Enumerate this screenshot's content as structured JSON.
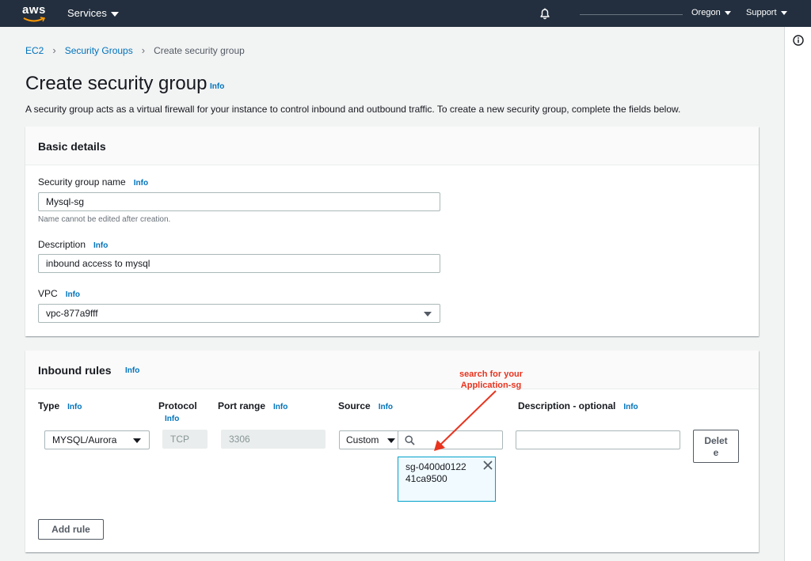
{
  "nav": {
    "logo_text": "aws",
    "services_label": "Services",
    "region_label": "Oregon",
    "support_label": "Support"
  },
  "breadcrumb": {
    "items": [
      "EC2",
      "Security Groups"
    ],
    "current": "Create security group"
  },
  "page": {
    "title": "Create security group",
    "info_label": "Info",
    "description": "A security group acts as a virtual firewall for your instance to control inbound and outbound traffic. To create a new security group, complete the fields below."
  },
  "basic_details": {
    "title": "Basic details",
    "name_label": "Security group name",
    "name_value": "Mysql-sg",
    "name_constraint": "Name cannot be edited after creation.",
    "description_label": "Description",
    "description_value": "inbound access to mysql",
    "vpc_label": "VPC",
    "vpc_value": "vpc-877a9fff"
  },
  "inbound": {
    "title": "Inbound rules",
    "columns": {
      "type": "Type",
      "protocol": "Protocol",
      "port_range": "Port range",
      "source": "Source",
      "description": "Description - optional"
    },
    "rule": {
      "type": "MYSQL/Aurora",
      "protocol": "TCP",
      "port_range": "3306",
      "source_type": "Custom",
      "source_token": "sg-0400d012241ca9500"
    },
    "delete_label": "Delete",
    "add_rule_label": "Add rule"
  },
  "annotation": {
    "text": "search for your Application-sg",
    "color": "#e8331e"
  },
  "colors": {
    "nav_bg": "#232f3e",
    "link": "#0073bb",
    "page_bg": "#f2f3f3"
  }
}
